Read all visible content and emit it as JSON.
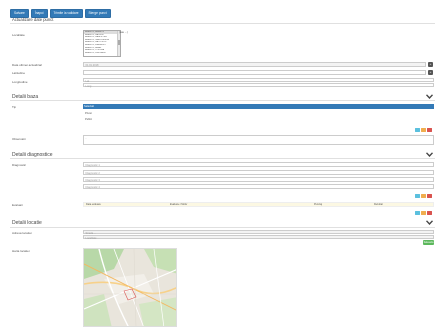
{
  "toolbar": {
    "buttons": [
      "Salvare",
      "Înapoi",
      "Trimite la validare",
      "Sterge punct"
    ]
  },
  "page_title": "Actualizare date punct",
  "form": {
    "localitate_label": "Localitate",
    "localitate_items": [
      "BRASOV, BRASOV",
      "BRASOV, SACELE",
      "BRASOV, SANPETRU",
      "BRASOV, TARLUNGENI",
      "BRASOV, SATU NOU",
      "BRASOV, ZARNESTI",
      "BRASOV, BRAN",
      "BRASOV, CODLEA",
      "BRASOV, PREJMER"
    ],
    "localitate_aside": "(sau ...)",
    "data_label": "Data ultimei actualizari",
    "data_value": "01.01.2018",
    "latitudine_label": "Latitudine",
    "longitudine_label": "Longitudine",
    "longitudine_values": [
      "Lat",
      "Long"
    ]
  },
  "sections": {
    "date_baza": "Detalii baza",
    "date_diagnostic": "Detalii diagnostice",
    "date_locatie": "Detalii locatie"
  },
  "baza": {
    "label": "Tip",
    "selected": "Selectati",
    "options": [
      "Privat",
      "Public"
    ],
    "obs_label": "Observatii",
    "obs_placeholder": "..."
  },
  "diagnostic": {
    "label": "Diagnostic",
    "lines": [
      "Diagnostic 1",
      "Diagnostic 2",
      "Diagnostic 3",
      "Diagnostic 4"
    ],
    "table_label": "Evaluari",
    "table_headers": [
      "Data evaluare",
      "Evaluare / Motiv",
      "Punctaj",
      "Rezultat"
    ]
  },
  "locatie": {
    "adresa_label": "Adresa locatiei",
    "adresa_values": [
      "Strada ...",
      "Localitate ..."
    ],
    "green_btn": "Salveaza",
    "harta_label": "Harta locatiei"
  },
  "colors": {
    "primary": "#337ab7",
    "success": "#5cb85c",
    "info": "#5bc0de",
    "warning": "#f0ad4e",
    "danger": "#d9534f"
  }
}
